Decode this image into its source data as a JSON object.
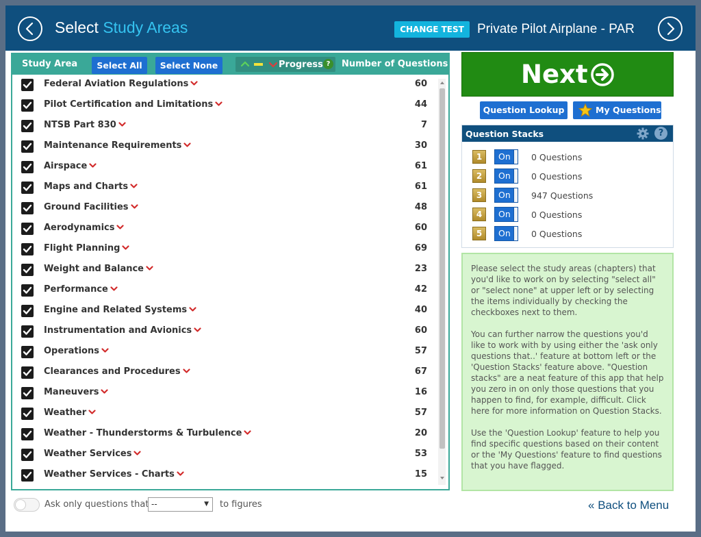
{
  "header": {
    "title_prefix": "Select",
    "title_accent": "Study Areas",
    "change_test_label": "CHANGE TEST",
    "test_name": "Private Pilot Airplane - PAR"
  },
  "study_list": {
    "header_label": "Study Area",
    "select_all_label": "Select All",
    "select_none_label": "Select None",
    "progress_label": "Progress",
    "num_questions_label": "Number of Questions",
    "items": [
      {
        "label": "Federal Aviation Regulations",
        "count": "60",
        "checked": true
      },
      {
        "label": "Pilot Certification and Limitations",
        "count": "44",
        "checked": true
      },
      {
        "label": "NTSB Part 830",
        "count": "7",
        "checked": true
      },
      {
        "label": "Maintenance Requirements",
        "count": "30",
        "checked": true
      },
      {
        "label": "Airspace",
        "count": "61",
        "checked": true
      },
      {
        "label": "Maps and Charts",
        "count": "61",
        "checked": true
      },
      {
        "label": "Ground Facilities",
        "count": "48",
        "checked": true
      },
      {
        "label": "Aerodynamics",
        "count": "60",
        "checked": true
      },
      {
        "label": "Flight Planning",
        "count": "69",
        "checked": true
      },
      {
        "label": "Weight and Balance",
        "count": "23",
        "checked": true
      },
      {
        "label": "Performance",
        "count": "42",
        "checked": true
      },
      {
        "label": "Engine and Related Systems",
        "count": "40",
        "checked": true
      },
      {
        "label": "Instrumentation and Avionics",
        "count": "60",
        "checked": true
      },
      {
        "label": "Operations",
        "count": "57",
        "checked": true
      },
      {
        "label": "Clearances and Procedures",
        "count": "67",
        "checked": true
      },
      {
        "label": "Maneuvers",
        "count": "16",
        "checked": true
      },
      {
        "label": "Weather",
        "count": "57",
        "checked": true
      },
      {
        "label": "Weather - Thunderstorms & Turbulence",
        "count": "20",
        "checked": true
      },
      {
        "label": "Weather Services",
        "count": "53",
        "checked": true
      },
      {
        "label": "Weather Services - Charts",
        "count": "15",
        "checked": true
      }
    ]
  },
  "bottom_filter": {
    "ask_label": "Ask only questions that",
    "select_value": "--",
    "suffix_label": "to figures"
  },
  "side": {
    "next_label": "Next",
    "question_lookup_label": "Question Lookup",
    "my_questions_label": "My Questions"
  },
  "stacks": {
    "title": "Question Stacks",
    "items": [
      {
        "num": "1",
        "toggle": "On",
        "count": "0 Questions"
      },
      {
        "num": "2",
        "toggle": "On",
        "count": "0 Questions"
      },
      {
        "num": "3",
        "toggle": "On",
        "count": "947 Questions"
      },
      {
        "num": "4",
        "toggle": "On",
        "count": "0 Questions"
      },
      {
        "num": "5",
        "toggle": "On",
        "count": "0 Questions"
      }
    ]
  },
  "info": {
    "paragraphs": [
      "Please select the study areas (chapters) that you'd like to work on by selecting \"select all\" or \"select none\" at upper left or by selecting the items individually by checking the checkboxes next to them.",
      "You can further narrow the questions you'd like to work with by using either the 'ask only questions that..' feature at bottom left or the 'Question Stacks' feature above. \"Question stacks\" are a neat feature of this app that help you zero in on only those questions that you happen to find, for example, difficult. Click here for more information on Question Stacks.",
      "Use the 'Question Lookup' feature to help you find specific questions based on their content or the 'My Questions' feature to find questions that you have flagged."
    ]
  },
  "footer": {
    "back_label": "Back to Menu"
  },
  "colors": {
    "header_bg": "#0f4f7e",
    "accent": "#35c3f0",
    "teal": "#3aa898",
    "button_blue": "#1e6fd1",
    "next_green": "#218b13",
    "chevron_red": "#d22b2b",
    "info_bg": "#d8f5d0"
  },
  "icons": {
    "prev": "chevron-left-circle-icon",
    "next": "chevron-right-circle-icon",
    "expand": "chevron-down-icon",
    "check": "checkmark-icon",
    "star": "star-icon",
    "gear": "gear-icon",
    "help": "question-mark-icon",
    "next_arrow": "arrow-right-circle-icon"
  }
}
